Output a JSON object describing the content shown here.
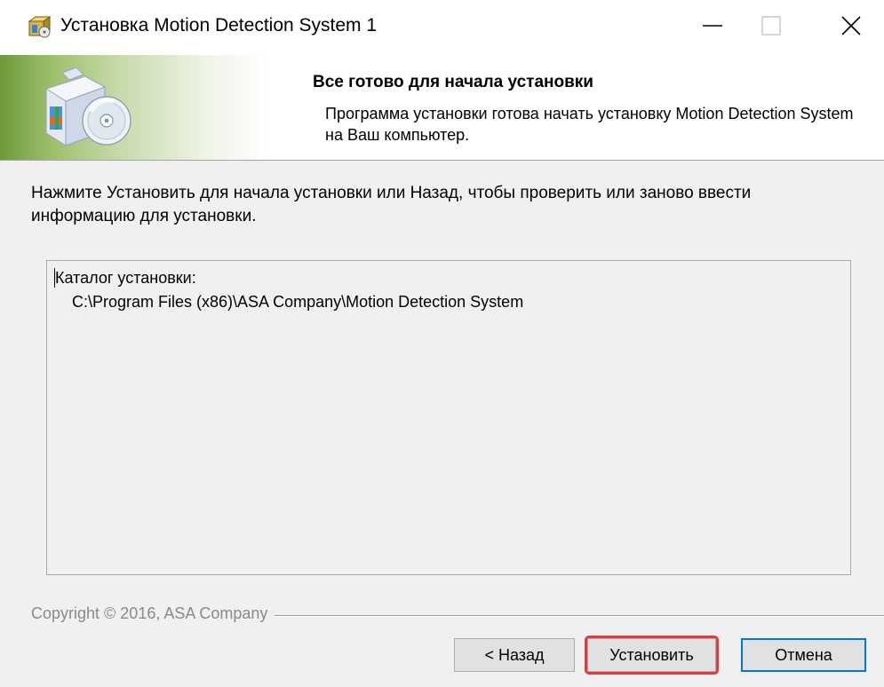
{
  "window": {
    "title": "Установка Motion Detection System 1",
    "app_icon": "installer-box-icon"
  },
  "titlebar_controls": {
    "minimize_icon": "minimize-icon",
    "maximize_icon": "maximize-icon",
    "close_icon": "close-icon"
  },
  "banner": {
    "title": "Все готово для начала установки",
    "subtitle": "Программа установки готова начать установку Motion Detection System на Ваш компьютер.",
    "icon": "software-box-cd-icon"
  },
  "body": {
    "instructions": "Нажмите Установить для начала установки или Назад, чтобы проверить или заново ввести информацию для установки.",
    "memo": {
      "line1": "Каталог установки:",
      "line2": "C:\\Program Files (x86)\\ASA Company\\Motion Detection System"
    }
  },
  "footer": {
    "copyright": "Copyright © 2016, ASA Company",
    "buttons": {
      "back": "< Назад",
      "install": "Установить",
      "cancel": "Отмена"
    }
  },
  "colors": {
    "highlight_outline": "#e33b3b",
    "default_button_border": "#0078d7",
    "banner_green": "#6e9a3a"
  }
}
